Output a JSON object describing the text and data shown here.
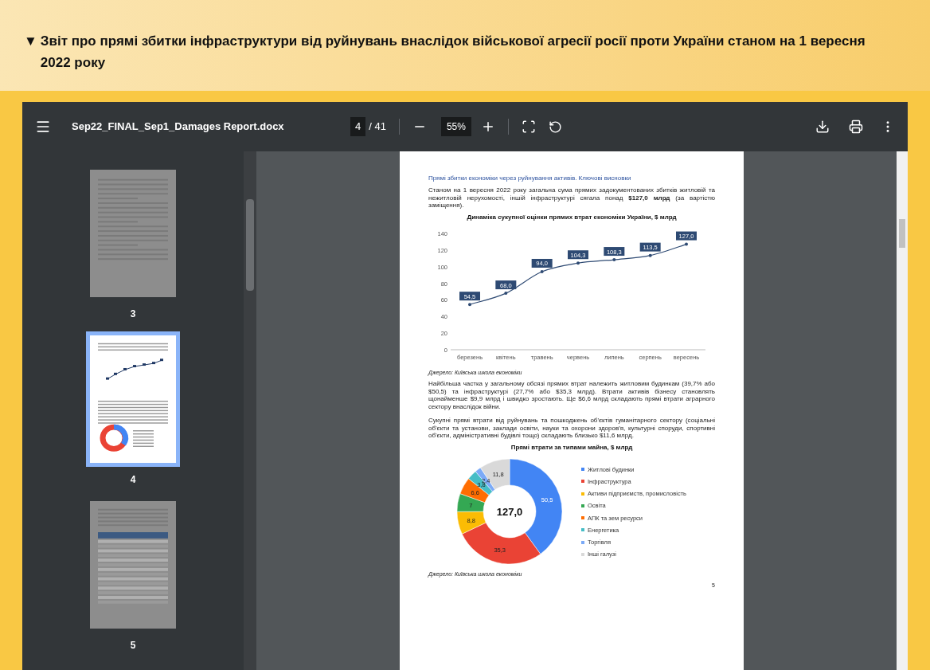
{
  "section": {
    "marker": "▼",
    "title": "Звіт про прямі збитки інфраструктури від руйнувань внаслідок військової агресії росії проти України станом на 1 вересня 2022 року"
  },
  "toolbar": {
    "filename": "Sep22_FINAL_Sep1_Damages Report.docx",
    "page": "4",
    "page_total": "/ 41",
    "zoom": "55%"
  },
  "thumbnails": [
    {
      "kind": "text",
      "label": "3",
      "selected": false
    },
    {
      "kind": "charts",
      "label": "4",
      "selected": true
    },
    {
      "kind": "table",
      "label": "5",
      "selected": false
    }
  ],
  "document_page": {
    "heading": "Прямі збитки економіки через руйнування активів. Ключові висновки",
    "paragraph_1": "Станом на 1 вересня 2022 року загальна сума прямих задокументованих збитків житловій та нежитловій нерухомості, іншій інфраструктурі сягала понад **$127,0 млрд** (за вартістю заміщення).",
    "line_chart": {
      "chart_data": {
        "type": "line",
        "title": "Динаміка сукупної оцінки прямих втрат економіки України, $ млрд",
        "categories": [
          "березень",
          "квітень",
          "травень",
          "червень",
          "липень",
          "серпень",
          "вересень"
        ],
        "series": [
          {
            "color": "#2e4a73",
            "values": [
              54.5,
              68.0,
              94.0,
              104.3,
              108.3,
              113.5,
              127.0
            ]
          }
        ],
        "ylim": [
          0,
          140
        ],
        "yticks": [
          0,
          20,
          40,
          60,
          80,
          100,
          120,
          140
        ],
        "value_labels": [
          "54,5",
          "68,0",
          "94,0",
          "104,3",
          "108,3",
          "113,5",
          "127,0"
        ]
      }
    },
    "source_1": "Джерело: Київська школа економіки",
    "paragraph_2": "Найбільша частка у загальному обсязі прямих втрат належить житловим будинкам (39,7% або $50,5) та інфраструктурі (27,7% або $35,3 млрд). Втрати активів бізнесу становлять щонайменше $9,9 млрд і швидко зростають. Ще $6,6 млрд складають прямі втрати аграрного сектору внаслідок війни.",
    "paragraph_3": "Сукупні прямі втрати від руйнувань та пошкоджень об'єктів гуманітарного сектору (соціальні об'єкти та установи, заклади освіти, науки та охорони здоров'я, культурні споруди, спортивні об'єкти, адміністративні будівлі тощо) складають близько $11,6 млрд.",
    "donut_chart": {
      "chart_data": {
        "type": "donut",
        "title": "Прямі втрати за типами майна, $ млрд",
        "categories": [
          "Житлові будинки",
          "Інфраструктура",
          "Активи підприємств, промисловість",
          "Освіта",
          "АПК та зем ресурси",
          "Енергетика",
          "Торгівля",
          "Інші галузі"
        ],
        "values": [
          50.5,
          35.3,
          8.8,
          7,
          6.6,
          3.8,
          2.4,
          11.8
        ],
        "value_labels": [
          "50,5",
          "35,3",
          "8,8",
          "7",
          "6,6",
          "3,8",
          "2,4",
          "11,8"
        ],
        "colors": [
          "#4285f4",
          "#ea4335",
          "#fbbc04",
          "#34a853",
          "#ff6d01",
          "#46bdc6",
          "#7baaf7",
          "#d9d9d9"
        ],
        "legend": "right"
      },
      "center_label": "127,0"
    },
    "source_2": "Джерело: Київська школа економіки",
    "page_number": "5"
  }
}
